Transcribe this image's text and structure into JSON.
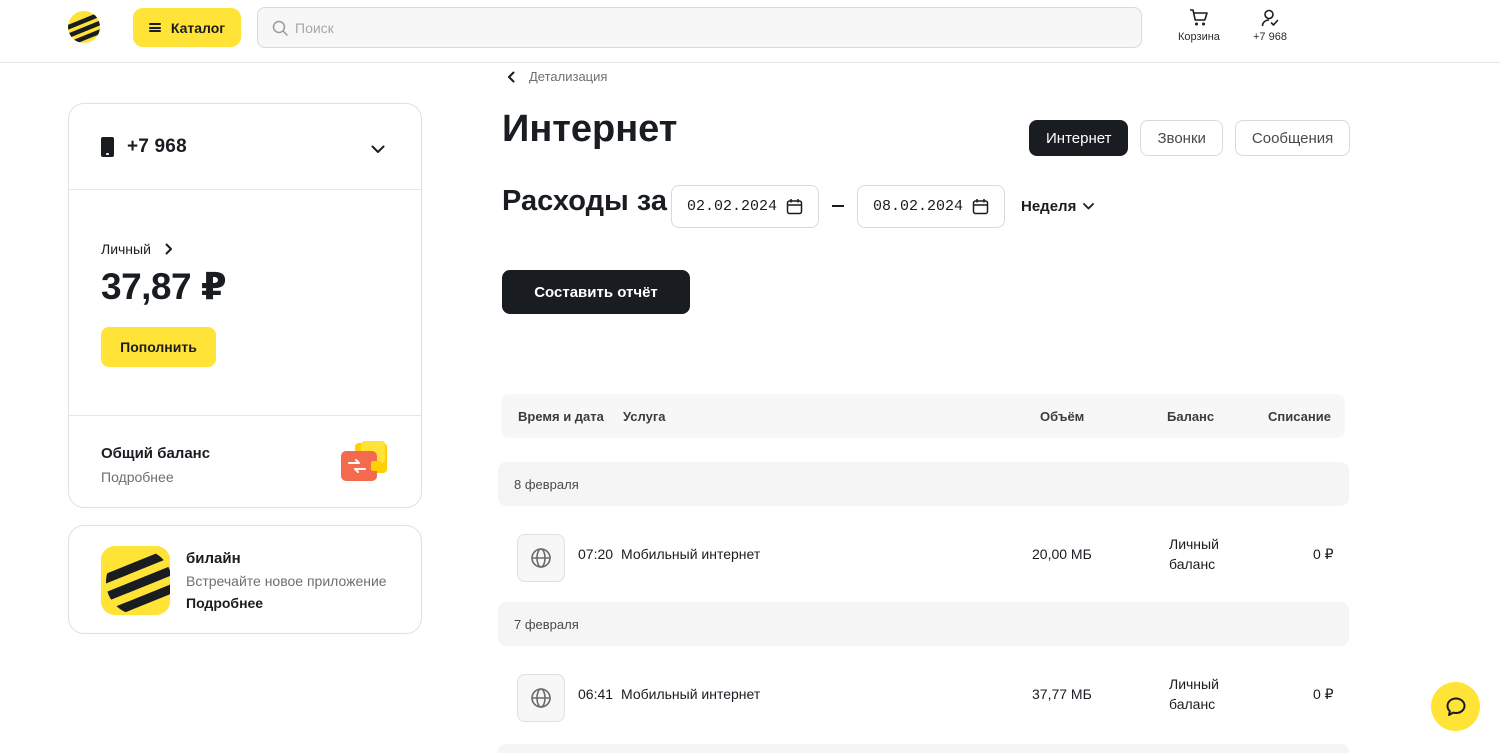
{
  "header": {
    "catalog_label": "Каталог",
    "search_placeholder": "Поиск",
    "cart_label": "Корзина",
    "profile_label": "+7 968"
  },
  "account": {
    "phone": "+7 968",
    "personal_label": "Личный",
    "balance": "37,87 ₽",
    "topup_label": "Пополнить",
    "common_balance_title": "Общий баланс",
    "common_balance_link": "Подробнее"
  },
  "app_promo": {
    "title": "билайн",
    "subtitle": "Встречайте новое приложение",
    "link": "Подробнее"
  },
  "page": {
    "back_label": "Детализация",
    "title": "Интернет",
    "tabs": [
      {
        "label": "Интернет",
        "active": true
      },
      {
        "label": "Звонки",
        "active": false
      },
      {
        "label": "Сообщения",
        "active": false
      }
    ],
    "period_label": "Расходы за",
    "date_from": "02.02.2024",
    "date_to": "08.02.2024",
    "period_select": "Неделя",
    "report_button": "Составить отчёт"
  },
  "table": {
    "headers": {
      "datetime": "Время и дата",
      "service": "Услуга",
      "volume": "Объём",
      "balance": "Баланс",
      "charge": "Списание"
    },
    "groups": [
      {
        "date": "8 февраля",
        "rows": [
          {
            "time": "07:20",
            "service": "Мобильный интернет",
            "volume": "20,00 МБ",
            "balance_line1": "Личный",
            "balance_line2": "баланс",
            "charge": "0 ₽"
          }
        ]
      },
      {
        "date": "7 февраля",
        "rows": [
          {
            "time": "06:41",
            "service": "Мобильный интернет",
            "volume": "37,77 МБ",
            "balance_line1": "Личный",
            "balance_line2": "баланс",
            "charge": "0 ₽"
          }
        ]
      }
    ]
  },
  "colors": {
    "brand_yellow": "#ffe337",
    "dark": "#191c21",
    "muted_text": "#6f6f6f",
    "border": "#e0e0e0"
  },
  "icons": [
    "beeline-logo-icon",
    "menu-icon",
    "search-icon",
    "cart-icon",
    "user-icon",
    "phone-icon",
    "chevron-down-icon",
    "chevron-right-icon",
    "chevron-left-icon",
    "wallet-icon",
    "calendar-icon",
    "globe-icon",
    "chat-icon"
  ]
}
